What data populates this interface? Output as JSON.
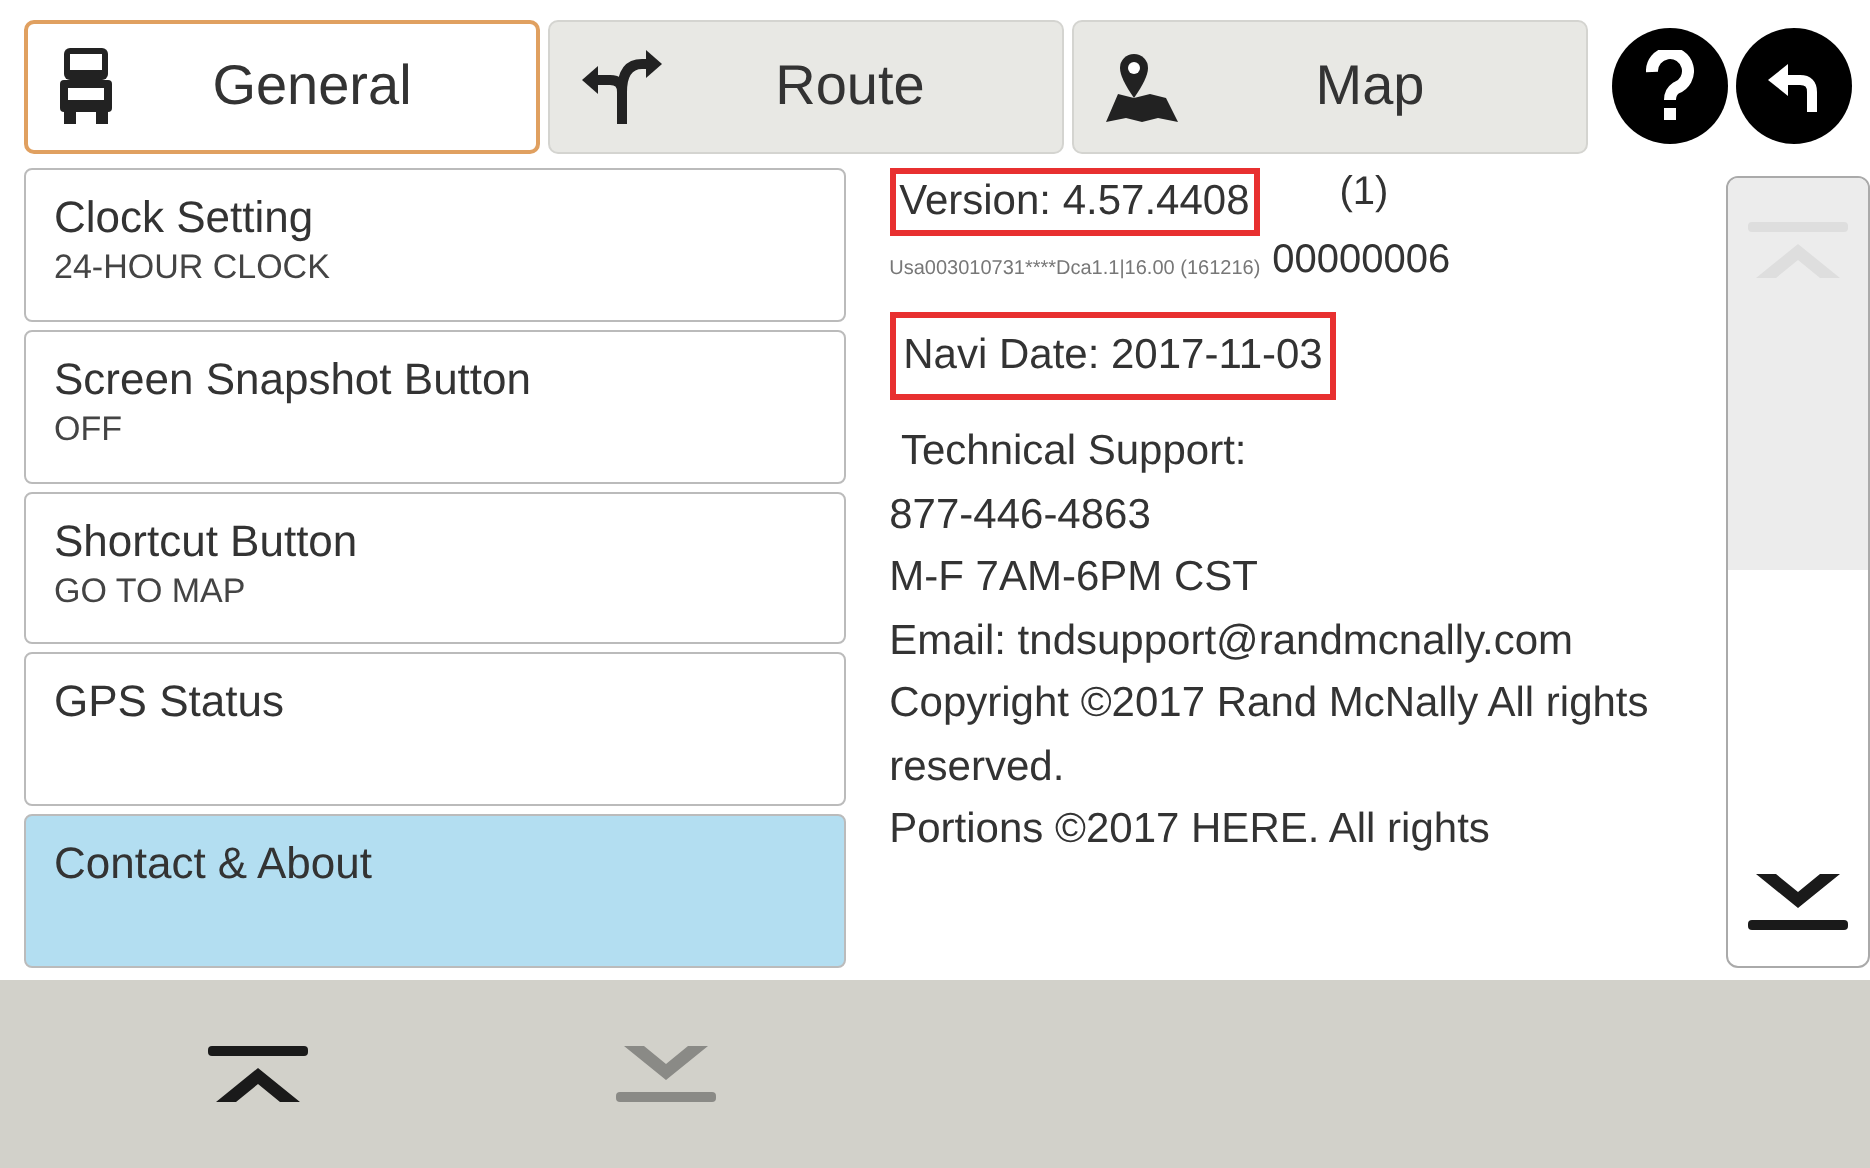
{
  "tabs": [
    {
      "kind": "truck",
      "label": "General",
      "selected": true
    },
    {
      "kind": "route",
      "label": "Route",
      "selected": false
    },
    {
      "kind": "map",
      "label": "Map",
      "selected": false
    }
  ],
  "settings": [
    {
      "title": "Clock Setting",
      "value": "24-HOUR CLOCK",
      "selected": false
    },
    {
      "title": "Screen Snapshot Button",
      "value": "OFF",
      "selected": false
    },
    {
      "title": "Shortcut Button",
      "value": "GO TO MAP",
      "selected": false
    },
    {
      "title": "GPS Status",
      "selected": false
    },
    {
      "title": "Contact & About",
      "selected": true
    }
  ],
  "about": {
    "version": "Version: 4.57.4408",
    "version_note": "(1)",
    "build": "Usa003010731****Dca1.1|16.00 (161216)",
    "build_number": "00000006",
    "navi_date": "Navi Date: 2017-11-03",
    "lines": [
      " Technical Support:",
      "877-446-4863",
      "M-F 7AM-6PM CST",
      "Email: tndsupport@randmcnally.com",
      "Copyright ©2017 Rand McNally All rights reserved.",
      "Portions ©2017 HERE. All rights"
    ]
  },
  "scroll_buttons": [
    {
      "kind": "up",
      "disabled": true
    },
    {
      "kind": "down",
      "disabled": false
    }
  ],
  "bottom_buttons": [
    {
      "kind": "up",
      "disabled": false
    },
    {
      "kind": "down",
      "disabled": true
    }
  ]
}
